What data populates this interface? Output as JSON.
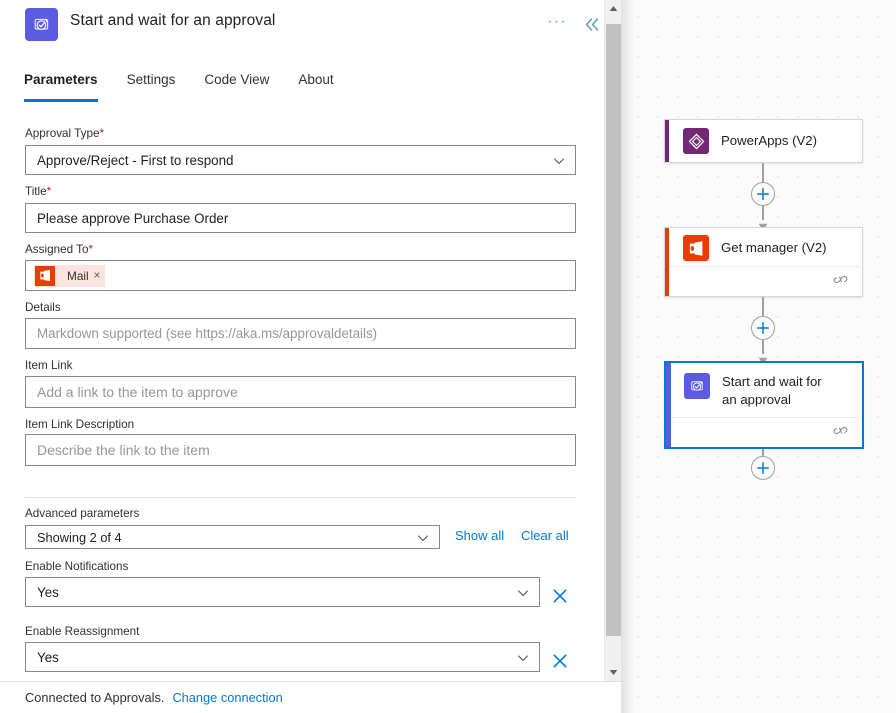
{
  "header": {
    "icon": "approvals-icon",
    "title": "Start and wait for an approval",
    "more_label": "···",
    "more_name": "more-options-icon",
    "collapse_name": "collapse-panel-icon"
  },
  "tabs": [
    {
      "label": "Parameters",
      "active": true
    },
    {
      "label": "Settings",
      "active": false
    },
    {
      "label": "Code View",
      "active": false
    },
    {
      "label": "About",
      "active": false
    }
  ],
  "form": {
    "approval_type": {
      "label": "Approval Type",
      "required": "*",
      "value": "Approve/Reject - First to respond"
    },
    "title": {
      "label": "Title",
      "required": "*",
      "value": "Please approve Purchase Order"
    },
    "assigned_to": {
      "label": "Assigned To",
      "required": "*",
      "token": "Mail",
      "token_remove": "×"
    },
    "details": {
      "label": "Details",
      "placeholder": "Markdown supported (see https://aka.ms/approvaldetails)"
    },
    "item_link": {
      "label": "Item Link",
      "placeholder": "Add a link to the item to approve"
    },
    "item_link_description": {
      "label": "Item Link Description",
      "placeholder": "Describe the link to the item"
    }
  },
  "advanced": {
    "label": "Advanced parameters",
    "selector_value": "Showing 2 of 4",
    "show_all": "Show all",
    "clear_all": "Clear all",
    "fields": [
      {
        "label": "Enable Notifications",
        "value": "Yes"
      },
      {
        "label": "Enable Reassignment",
        "value": "Yes"
      }
    ]
  },
  "footer": {
    "status": "Connected to Approvals.",
    "change_connection": "Change connection"
  },
  "canvas": {
    "nodes": [
      {
        "title": "PowerApps (V2)",
        "icon": "powerapps-icon",
        "accent": "#742774",
        "selected": false,
        "has_footer": false
      },
      {
        "title": "Get manager (V2)",
        "icon": "office365-users-icon",
        "accent": "#eb3c00",
        "selected": false,
        "has_footer": true
      },
      {
        "title": "Start and wait for an approval",
        "icon": "approvals-icon",
        "accent": "#5c5ce0",
        "selected": true,
        "has_footer": true
      }
    ],
    "add_step_label": "+",
    "add_step_name": "add-step-button"
  },
  "colors": {
    "accent_blue": "#0078d4",
    "link_blue": "#0078d4",
    "required_red": "#a4262c",
    "approvals_purple": "#5c5ce0",
    "powerapps_purple": "#742774",
    "office_orange": "#eb3c00"
  }
}
